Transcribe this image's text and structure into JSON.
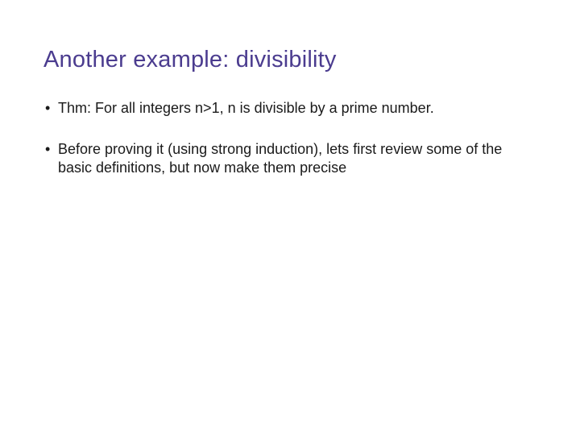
{
  "slide": {
    "title": "Another example: divisibility",
    "bullets": [
      {
        "marker": "•",
        "text": "Thm: For all integers n>1, n is divisible by a prime number."
      },
      {
        "marker": "•",
        "text": "Before proving it (using strong induction), lets first review some of the basic definitions, but now make them precise"
      }
    ]
  }
}
